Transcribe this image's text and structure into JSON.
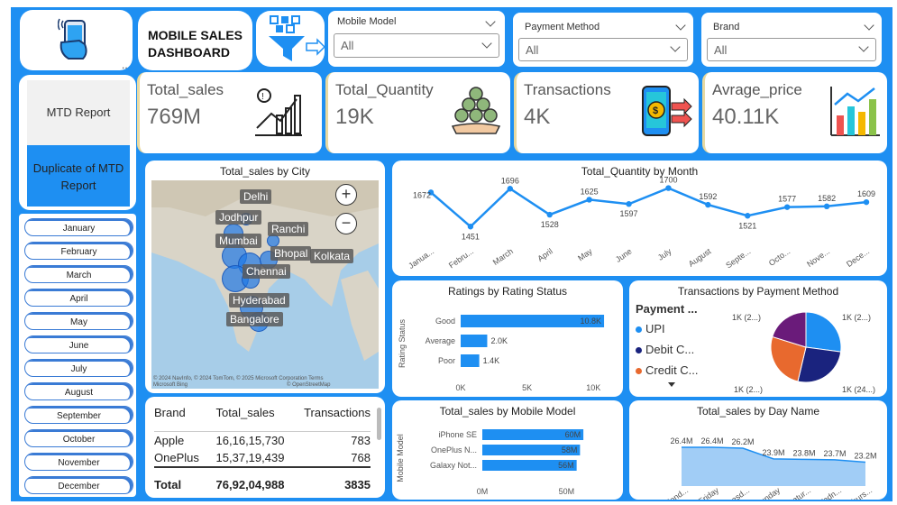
{
  "header": {
    "title_line1": "MOBILE SALES",
    "title_line2": "DASHBOARD",
    "more": "..."
  },
  "slicers": [
    {
      "label": "Mobile Model",
      "value": "All"
    },
    {
      "label": "Payment Method",
      "value": "All"
    },
    {
      "label": "Brand",
      "value": "All"
    }
  ],
  "nav": {
    "mtd": "MTD Report",
    "dup": "Duplicate of MTD Report"
  },
  "kpis": [
    {
      "label": "Total_sales",
      "value": "769M"
    },
    {
      "label": "Total_Quantity",
      "value": "19K"
    },
    {
      "label": "Transactions",
      "value": "4K"
    },
    {
      "label": "Avrage_price",
      "value": "40.11K"
    }
  ],
  "months": [
    "January",
    "February",
    "March",
    "April",
    "May",
    "June",
    "July",
    "August",
    "September",
    "October",
    "November",
    "December"
  ],
  "map": {
    "title": "Total_sales by City",
    "cities": [
      "Delhi",
      "Jodhpur",
      "Ranchi",
      "Mumbai",
      "Bhopal",
      "Kolkata",
      "Chennai",
      "Hyderabad",
      "Bangalore"
    ],
    "zoom_in": "+",
    "zoom_out": "−",
    "credit1": "© 2024 NavInfo, © 2024 TomTom, © 2025 Microsoft Corporation",
    "credit2": "Terms",
    "credit3": "© OpenStreetMap",
    "credit_logo": "Microsoft Bing"
  },
  "table": {
    "headers": [
      "Brand",
      "Total_sales",
      "Transactions"
    ],
    "rows": [
      [
        "Apple",
        "16,16,15,730",
        "783"
      ],
      [
        "OnePlus",
        "15,37,19,439",
        "768"
      ]
    ],
    "total": [
      "Total",
      "76,92,04,988",
      "3835"
    ]
  },
  "chart_data": [
    {
      "type": "line",
      "title": "Total_Quantity by Month",
      "categories": [
        "Janua...",
        "Febru...",
        "March",
        "April",
        "May",
        "June",
        "July",
        "August",
        "Septe...",
        "Octo...",
        "Nove...",
        "Dece..."
      ],
      "values": [
        1672,
        1451,
        1696,
        1528,
        1625,
        1597,
        1700,
        1592,
        1521,
        1577,
        1582,
        1609
      ],
      "color": "#1E8FF2"
    },
    {
      "type": "bar",
      "title": "Ratings by Rating Status",
      "ylabel": "Rating Status",
      "categories": [
        "Good",
        "Average",
        "Poor"
      ],
      "values": [
        10800,
        2000,
        1400
      ],
      "data_labels": [
        "10.8K",
        "2.0K",
        "1.4K"
      ],
      "x_ticks": [
        "0K",
        "5K",
        "10K"
      ],
      "xlim": [
        0,
        11000
      ],
      "color": "#1E8FF2"
    },
    {
      "type": "pie",
      "title": "Transactions by Payment Method",
      "legend_title": "Payment ...",
      "legend": [
        {
          "name": "UPI",
          "color": "#1E8FF2"
        },
        {
          "name": "Debit C...",
          "color": "#1A237E"
        },
        {
          "name": "Credit C...",
          "color": "#E8692E"
        }
      ],
      "values": [
        1040,
        1020,
        1000,
        775
      ],
      "colors": [
        "#1E8FF2",
        "#1A237E",
        "#E8692E",
        "#6A1B7A"
      ],
      "data_labels": [
        "1K (2...)",
        "1K (24...)",
        "1K (2...)",
        "1K (2...)"
      ]
    },
    {
      "type": "bar",
      "title": "Total_sales by Mobile Model",
      "ylabel": "Mobile Model",
      "categories": [
        "iPhone SE",
        "OnePlus N...",
        "Galaxy Not..."
      ],
      "values": [
        60,
        58,
        56
      ],
      "data_labels": [
        "60M",
        "58M",
        "56M"
      ],
      "x_ticks": [
        "0M",
        "50M"
      ],
      "xlim": [
        0,
        76
      ],
      "color": "#1E8FF2"
    },
    {
      "type": "area",
      "title": "Total_sales by Day Name",
      "categories": [
        "Mond...",
        "Friday",
        "Tuesd...",
        "Sunday",
        "Satur...",
        "Wedn...",
        "Thurs..."
      ],
      "values": [
        26.4,
        26.4,
        26.2,
        23.9,
        23.8,
        23.7,
        23.2
      ],
      "data_labels": [
        "26.4M",
        "26.4M",
        "26.2M",
        "23.9M",
        "23.8M",
        "23.7M",
        "23.2M"
      ],
      "color": "#90C4F5"
    }
  ]
}
